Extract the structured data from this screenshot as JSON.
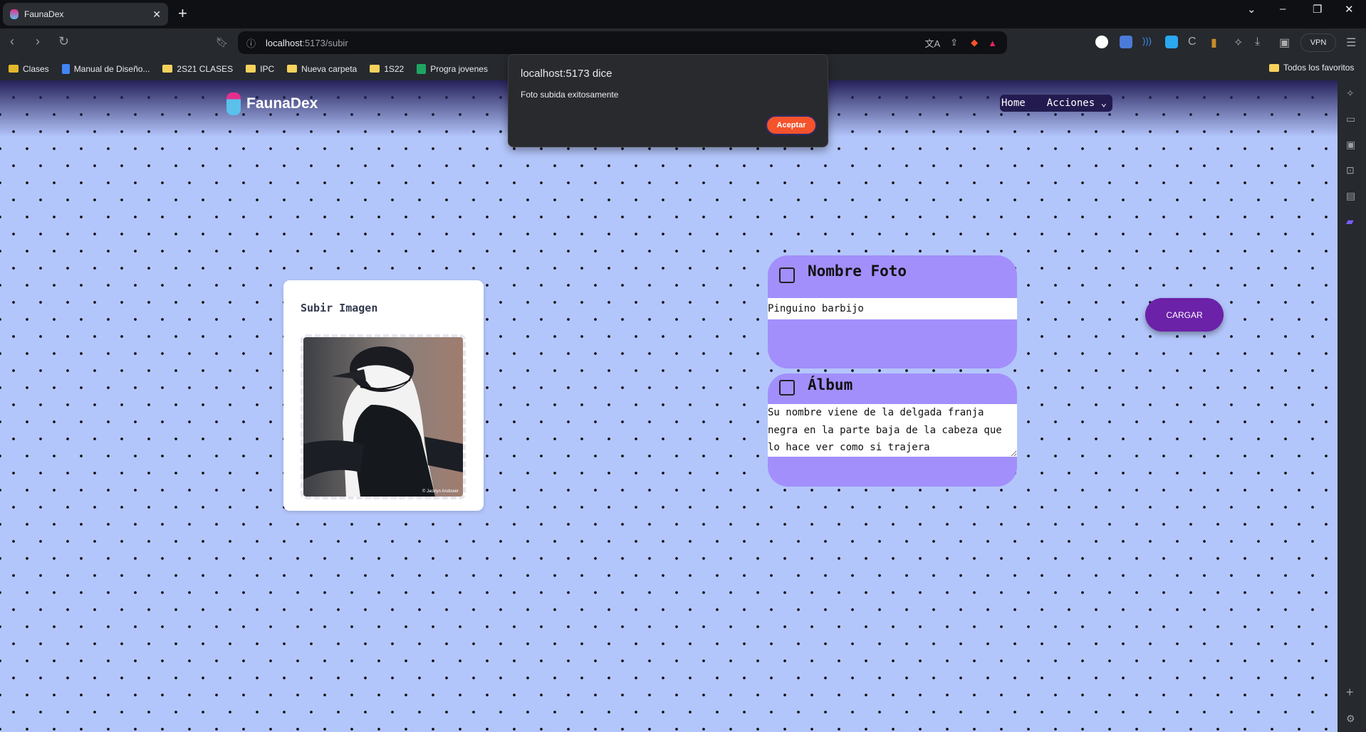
{
  "browser": {
    "tab_title": "FaunaDex",
    "url_host": "localhost",
    "url_rest": ":5173/subir",
    "bookmarks": [
      "Clases",
      "Manual de Diseño...",
      "2S21 CLASES",
      "IPC",
      "Nueva carpeta",
      "1S22",
      "Progra jovenes"
    ],
    "all_favorites": "Todos los favoritos",
    "vpn_label": "VPN"
  },
  "dialog": {
    "title": "localhost:5173 dice",
    "message": "Foto subida exitosamente",
    "ok_label": "Aceptar"
  },
  "app": {
    "brand": "FaunaDex",
    "nav": {
      "home": "Home",
      "actions": "Acciones"
    },
    "upload_card": {
      "title": "Subir Imagen",
      "image_credit": "© Jacklyn Andower"
    },
    "name_card": {
      "title": "Nombre Foto",
      "value": "Pinguino barbijo"
    },
    "album_card": {
      "title": "Álbum",
      "value": "Su nombre viene de la delgada franja negra en la parte baja de la cabeza que lo hace ver como si trajera"
    },
    "submit_label": "CARGAR"
  },
  "colors": {
    "page_bg": "#b3c6fb",
    "card_purple": "#a28ffb",
    "submit": "#6b21a8",
    "nav": "#231b4f",
    "dialog_ok": "#f4532c"
  }
}
